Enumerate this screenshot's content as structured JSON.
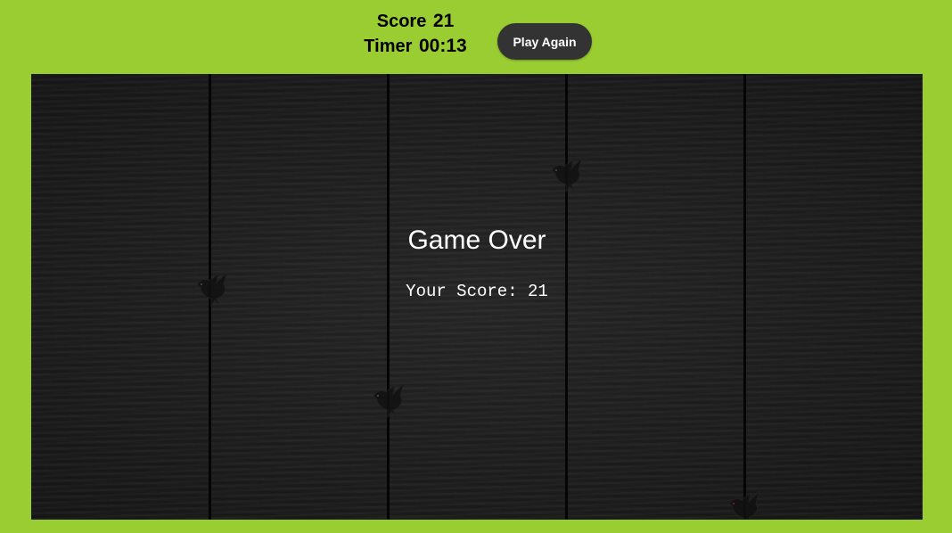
{
  "hud": {
    "score_label": "Score",
    "score_value": "21",
    "timer_label": "Timer",
    "timer_value": "00:13",
    "play_again_label": "Play Again"
  },
  "game_over": {
    "title": "Game Over",
    "score_text": "Your Score: 21"
  },
  "colors": {
    "background": "#9acd32",
    "board": "#1c1c1c",
    "button": "#333333"
  },
  "icons": [
    "crow-icon"
  ]
}
